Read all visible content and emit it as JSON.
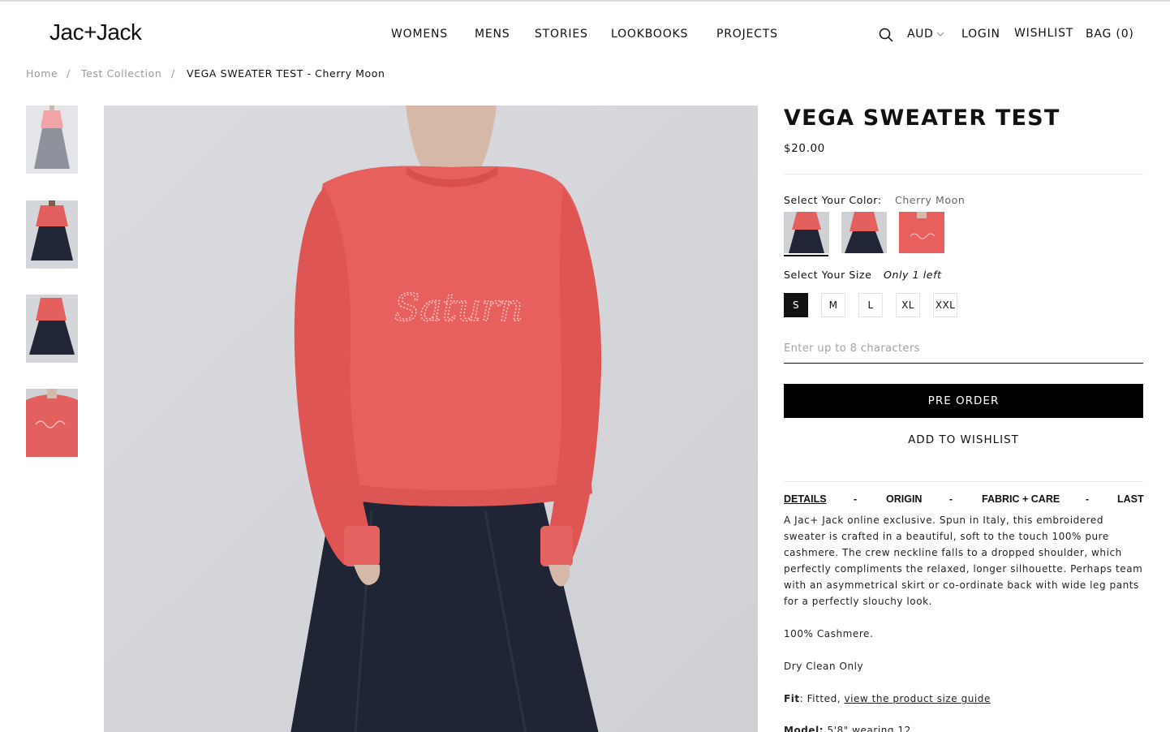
{
  "header": {
    "logo": "Jac+Jack",
    "nav": [
      "WOMENS",
      "MENS",
      "STORIES",
      "LOOKBOOKS",
      "PROJECTS"
    ],
    "currency": "AUD",
    "login": "LOGIN",
    "wishlist": "WISHLIST",
    "bag": "BAG (0)"
  },
  "breadcrumb": {
    "home": "Home",
    "collection": "Test Collection",
    "current": "VEGA SWEATER TEST - Cherry Moon",
    "separator": "/"
  },
  "product": {
    "title": "VEGA SWEATER TEST",
    "price": "$20.00",
    "color_label": "Select Your Color:",
    "color_value": "Cherry Moon",
    "size_label": "Select Your Size",
    "stock_note": "Only 1 left",
    "sizes": [
      "S",
      "M",
      "L",
      "XL",
      "XXL"
    ],
    "selected_size": "S",
    "monogram_placeholder": "Enter up to 8 characters",
    "preorder_label": "PRE ORDER",
    "wishlist_label": "ADD TO WISHLIST",
    "image_text": "Saturn"
  },
  "tabs": {
    "items": [
      "DETAILS",
      "ORIGIN",
      "FABRIC + CARE",
      "LAST"
    ],
    "separator": "-",
    "active": "DETAILS"
  },
  "details": {
    "description": "A Jac+ Jack online exclusive. Spun in Italy, this embroidered sweater is crafted in a beautiful, soft to the touch 100% pure cashmere. The crew neckline falls to a dropped shoulder, which perfectly compliments the relaxed, longer silhouette. Perhaps team with an asymmetrical skirt or co-ordinate back with wide leg pants for a perfectly slouchy look.",
    "composition": "100% Cashmere.",
    "care": "Dry Clean Only",
    "fit_label": "Fit",
    "fit_value": ": Fitted, ",
    "fit_link": "view the product size guide",
    "model_label": "Model:",
    "model_value": " 5'8\" wearing 12"
  },
  "colors": {
    "sweater": "#e8605e",
    "skirt": "#1f2535",
    "backdrop": "#d9d9dc",
    "button": "#000000"
  },
  "icons": {
    "search": "search-icon",
    "currency_toggle": "chevron-down-icon"
  }
}
